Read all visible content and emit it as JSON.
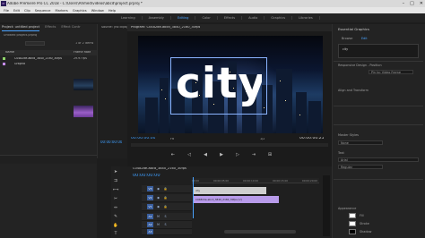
{
  "title_bar": {
    "text": "Adobe Premiere Pro CC 2018 - C:\\Users\\Ahmed\\videos\\abcd\\project.prproj *",
    "icon_label": "Pr",
    "controls": [
      "–",
      "□",
      "✕"
    ]
  },
  "menu": [
    "File",
    "Edit",
    "Clip",
    "Sequence",
    "Markers",
    "Graphics",
    "Window",
    "Help"
  ],
  "workspaces": [
    {
      "label": "Learning",
      "active": false
    },
    {
      "label": "Assembly",
      "active": false
    },
    {
      "label": "Editing",
      "active": true
    },
    {
      "label": "Color",
      "active": false
    },
    {
      "label": "Effects",
      "active": false
    },
    {
      "label": "Audio",
      "active": false
    },
    {
      "label": "Graphics",
      "active": false
    },
    {
      "label": "Libraries",
      "active": false
    }
  ],
  "project_panel": {
    "tabs": [
      {
        "label": "Project: untitled project",
        "active": true
      },
      {
        "label": "Effects",
        "active": false
      },
      {
        "label": "Effect Contr",
        "active": false
      }
    ],
    "path": "Untitled project.prproj",
    "item_count": "1 of 2 Items",
    "column_name": "Name",
    "column_rate": "Frame Rate",
    "items": [
      {
        "name": "C0482de-abcd_3840_2160_30fps",
        "rate": "29.97 fps"
      },
      {
        "name": "Graphic",
        "rate": ""
      }
    ]
  },
  "source_panel": {
    "label": "Source: (no clips)",
    "timecode": "00:00:00:00"
  },
  "program_monitor": {
    "tab": "Program: C0482de-abcd_3840_2160_30fps",
    "title_text": "city",
    "current_time": "00:00:00:00",
    "fit": "Fit",
    "resolution": "1/2",
    "duration": "00:00:00:25"
  },
  "transport": [
    "⇤",
    "◁",
    "◀",
    "▶",
    "▷",
    "⇥",
    "⊞"
  ],
  "essential_graphics": {
    "header": "Essential Graphics",
    "tabs": [
      "Browse",
      "Edit"
    ],
    "layers": [
      "city"
    ],
    "sections": [
      {
        "title": "Responsive Design - Position",
        "value": "Pin to: Video Frame"
      },
      {
        "title": "Align and Transform",
        "value": ""
      },
      {
        "title": "Master Styles",
        "value": "None"
      },
      {
        "title": "Text",
        "value": "Arial"
      },
      {
        "title": "Appearance",
        "value": ""
      }
    ],
    "font_style": "Regular",
    "fill_label": "Fill",
    "stroke_label": "Stroke",
    "shadow_label": "Shadow"
  },
  "timeline": {
    "tab": "C0482de-abcd_3840_2160_30fps",
    "timecode": "00:00:00:00",
    "ruler": [
      "00:00",
      "00:00:05:00",
      "00:00:10:00",
      "00:00:15:00",
      "00:00:20:00"
    ],
    "tracks": [
      {
        "label": "V3",
        "clip": ""
      },
      {
        "label": "V2",
        "clip": "city"
      },
      {
        "label": "V1",
        "clip": "C0482de-abcd_3840_2160_30fps [V]"
      },
      {
        "label": "A1",
        "clip": ""
      },
      {
        "label": "A2",
        "clip": ""
      },
      {
        "label": "A3",
        "clip": ""
      }
    ]
  },
  "colors": {
    "accent": "#4aa3ff",
    "clip_v1": "#b89bea",
    "clip_v2": "#cfcfcf",
    "panel": "#232323"
  }
}
